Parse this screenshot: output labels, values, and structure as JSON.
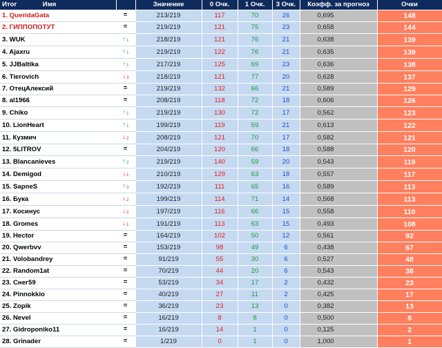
{
  "headers": {
    "rank": "Итог",
    "name": "Имя",
    "value": "Значение",
    "o0": "0 Очк.",
    "o1": "1 Очк.",
    "o3": "3 Очк.",
    "coef": "Коэфф. за прогноз",
    "points": "Очки"
  },
  "rows": [
    {
      "name": "1. QueridaGata",
      "top": true,
      "trend": "=",
      "trend_dir": "eq",
      "trend_n": "",
      "value": "213/219",
      "o0": "117",
      "o1": "70",
      "o3": "26",
      "coef": "0,695",
      "points": "148"
    },
    {
      "name": "2. ГИППОПОТУТ",
      "top": true,
      "trend": "=",
      "trend_dir": "eq",
      "trend_n": "",
      "value": "219/219",
      "o0": "121",
      "o1": "75",
      "o3": "23",
      "coef": "0,658",
      "points": "144"
    },
    {
      "name": "3. WUK",
      "top": false,
      "trend": "↑",
      "trend_dir": "up",
      "trend_n": "1",
      "value": "218/219",
      "o0": "121",
      "o1": "76",
      "o3": "21",
      "coef": "0,638",
      "points": "139"
    },
    {
      "name": "4. Ajaxru",
      "top": false,
      "trend": "↑",
      "trend_dir": "up",
      "trend_n": "1",
      "value": "219/219",
      "o0": "122",
      "o1": "76",
      "o3": "21",
      "coef": "0,635",
      "points": "139"
    },
    {
      "name": "5. JJBaltika",
      "top": false,
      "trend": "↑",
      "trend_dir": "up",
      "trend_n": "1",
      "value": "217/219",
      "o0": "125",
      "o1": "69",
      "o3": "23",
      "coef": "0,636",
      "points": "138"
    },
    {
      "name": "6. Tierovich",
      "top": false,
      "trend": "↓",
      "trend_dir": "down",
      "trend_n": "3",
      "value": "218/219",
      "o0": "121",
      "o1": "77",
      "o3": "20",
      "coef": "0,628",
      "points": "137"
    },
    {
      "name": "7. ОтецАлексий",
      "top": false,
      "trend": "=",
      "trend_dir": "eq",
      "trend_n": "",
      "value": "219/219",
      "o0": "132",
      "o1": "66",
      "o3": "21",
      "coef": "0,589",
      "points": "129"
    },
    {
      "name": "8. al1966",
      "top": false,
      "trend": "=",
      "trend_dir": "eq",
      "trend_n": "",
      "value": "208/219",
      "o0": "118",
      "o1": "72",
      "o3": "18",
      "coef": "0,606",
      "points": "126"
    },
    {
      "name": "9. Chiko",
      "top": false,
      "trend": "↑",
      "trend_dir": "up",
      "trend_n": "1",
      "value": "219/219",
      "o0": "130",
      "o1": "72",
      "o3": "17",
      "coef": "0,562",
      "points": "123"
    },
    {
      "name": "10. LionHeart",
      "top": false,
      "trend": "↑",
      "trend_dir": "up",
      "trend_n": "1",
      "value": "199/219",
      "o0": "119",
      "o1": "59",
      "o3": "21",
      "coef": "0,613",
      "points": "122"
    },
    {
      "name": "11. Кузмич",
      "top": false,
      "trend": "↓",
      "trend_dir": "down",
      "trend_n": "2",
      "value": "208/219",
      "o0": "121",
      "o1": "70",
      "o3": "17",
      "coef": "0,582",
      "points": "121"
    },
    {
      "name": "12. 5LITROV",
      "top": false,
      "trend": "=",
      "trend_dir": "eq",
      "trend_n": "",
      "value": "204/219",
      "o0": "120",
      "o1": "66",
      "o3": "18",
      "coef": "0,588",
      "points": "120"
    },
    {
      "name": "13. Blancanieves",
      "top": false,
      "trend": "↑",
      "trend_dir": "up",
      "trend_n": "2",
      "value": "219/219",
      "o0": "140",
      "o1": "59",
      "o3": "20",
      "coef": "0,543",
      "points": "119"
    },
    {
      "name": "14. Demigod",
      "top": false,
      "trend": "↓",
      "trend_dir": "down",
      "trend_n": "1",
      "value": "210/219",
      "o0": "129",
      "o1": "63",
      "o3": "18",
      "coef": "0,557",
      "points": "117"
    },
    {
      "name": "15. SapneS",
      "top": false,
      "trend": "↑",
      "trend_dir": "up",
      "trend_n": "3",
      "value": "192/219",
      "o0": "111",
      "o1": "65",
      "o3": "16",
      "coef": "0,589",
      "points": "113"
    },
    {
      "name": "16. Бука",
      "top": false,
      "trend": "↓",
      "trend_dir": "down",
      "trend_n": "2",
      "value": "199/219",
      "o0": "114",
      "o1": "71",
      "o3": "14",
      "coef": "0,568",
      "points": "113"
    },
    {
      "name": "17. Косинус",
      "top": false,
      "trend": "↓",
      "trend_dir": "down",
      "trend_n": "2",
      "value": "197/219",
      "o0": "116",
      "o1": "66",
      "o3": "15",
      "coef": "0,558",
      "points": "110"
    },
    {
      "name": "18. Gromes",
      "top": false,
      "trend": "↓",
      "trend_dir": "down",
      "trend_n": "1",
      "value": "191/219",
      "o0": "113",
      "o1": "63",
      "o3": "15",
      "coef": "0,493",
      "points": "108"
    },
    {
      "name": "19. Hector",
      "top": false,
      "trend": "=",
      "trend_dir": "eq",
      "trend_n": "",
      "value": "164/219",
      "o0": "102",
      "o1": "50",
      "o3": "12",
      "coef": "0,561",
      "points": "92"
    },
    {
      "name": "20. Qwerbvv",
      "top": false,
      "trend": "=",
      "trend_dir": "eq",
      "trend_n": "",
      "value": "153/219",
      "o0": "98",
      "o1": "49",
      "o3": "6",
      "coef": "0,438",
      "points": "67"
    },
    {
      "name": "21. Volobandrey",
      "top": false,
      "trend": "=",
      "trend_dir": "eq",
      "trend_n": "",
      "value": "91/219",
      "o0": "55",
      "o1": "30",
      "o3": "6",
      "coef": "0,527",
      "points": "48"
    },
    {
      "name": "22. Random1at",
      "top": false,
      "trend": "=",
      "trend_dir": "eq",
      "trend_n": "",
      "value": "70/219",
      "o0": "44",
      "o1": "20",
      "o3": "6",
      "coef": "0,543",
      "points": "38"
    },
    {
      "name": "23. Снег59",
      "top": false,
      "trend": "=",
      "trend_dir": "eq",
      "trend_n": "",
      "value": "53/219",
      "o0": "34",
      "o1": "17",
      "o3": "2",
      "coef": "0,432",
      "points": "23"
    },
    {
      "name": "24. Pinnokkio",
      "top": false,
      "trend": "=",
      "trend_dir": "eq",
      "trend_n": "",
      "value": "40/219",
      "o0": "27",
      "o1": "11",
      "o3": "2",
      "coef": "0,425",
      "points": "17"
    },
    {
      "name": "25. Zopik",
      "top": false,
      "trend": "=",
      "trend_dir": "eq",
      "trend_n": "",
      "value": "36/219",
      "o0": "23",
      "o1": "13",
      "o3": "0",
      "coef": "0,382",
      "points": "13"
    },
    {
      "name": "26. Nevel",
      "top": false,
      "trend": "=",
      "trend_dir": "eq",
      "trend_n": "",
      "value": "16/219",
      "o0": "8",
      "o1": "8",
      "o3": "0",
      "coef": "0,500",
      "points": "8"
    },
    {
      "name": "27. Gidroponiko11",
      "top": false,
      "trend": "=",
      "trend_dir": "eq",
      "trend_n": "",
      "value": "16/219",
      "o0": "14",
      "o1": "1",
      "o3": "0",
      "coef": "0,125",
      "points": "2"
    },
    {
      "name": "28. Grinader",
      "top": false,
      "trend": "=",
      "trend_dir": "eq",
      "trend_n": "",
      "value": "1/219",
      "o0": "0",
      "o1": "1",
      "o3": "0",
      "coef": "1,000",
      "points": "1"
    }
  ]
}
